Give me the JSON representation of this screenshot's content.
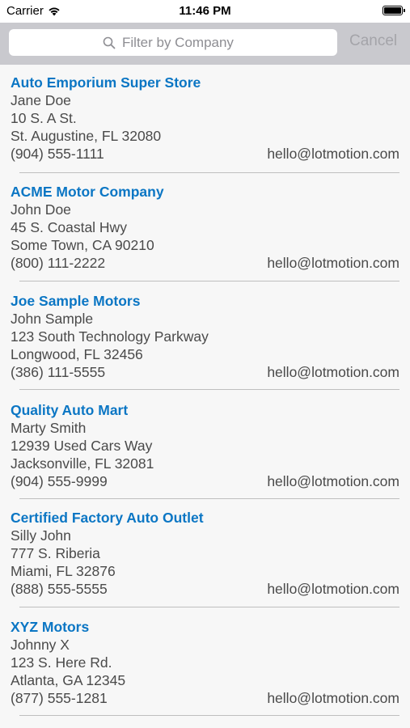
{
  "status_bar": {
    "carrier": "Carrier",
    "time": "11:46 PM"
  },
  "search": {
    "placeholder": "Filter by Company",
    "cancel_label": "Cancel"
  },
  "colors": {
    "company_link": "#0b76c4",
    "search_bar_bg": "#c9c9ce",
    "list_bg": "#f7f7f7"
  },
  "dealers": [
    {
      "company": "Auto Emporium Super Store",
      "contact": "Jane Doe",
      "address": "10 S. A St.",
      "city_state_zip": "St. Augustine, FL 32080",
      "phone": "(904) 555-1111",
      "email": "hello@lotmotion.com"
    },
    {
      "company": "ACME Motor Company",
      "contact": "John Doe",
      "address": "45 S. Coastal Hwy",
      "city_state_zip": "Some Town, CA 90210",
      "phone": "(800) 111-2222",
      "email": "hello@lotmotion.com"
    },
    {
      "company": "Joe Sample Motors",
      "contact": "John Sample",
      "address": "123 South Technology Parkway",
      "city_state_zip": "Longwood, FL 32456",
      "phone": "(386) 111-5555",
      "email": "hello@lotmotion.com"
    },
    {
      "company": "Quality Auto Mart",
      "contact": "Marty Smith",
      "address": "12939 Used Cars Way",
      "city_state_zip": "Jacksonville, FL 32081",
      "phone": "(904) 555-9999",
      "email": "hello@lotmotion.com"
    },
    {
      "company": "Certified Factory Auto Outlet",
      "contact": "Silly John",
      "address": "777 S. Riberia",
      "city_state_zip": "Miami, FL 32876",
      "phone": "(888) 555-5555",
      "email": "hello@lotmotion.com"
    },
    {
      "company": "XYZ Motors",
      "contact": "Johnny X",
      "address": "123 S. Here Rd.",
      "city_state_zip": "Atlanta, GA 12345",
      "phone": "(877) 555-1281",
      "email": "hello@lotmotion.com"
    }
  ]
}
